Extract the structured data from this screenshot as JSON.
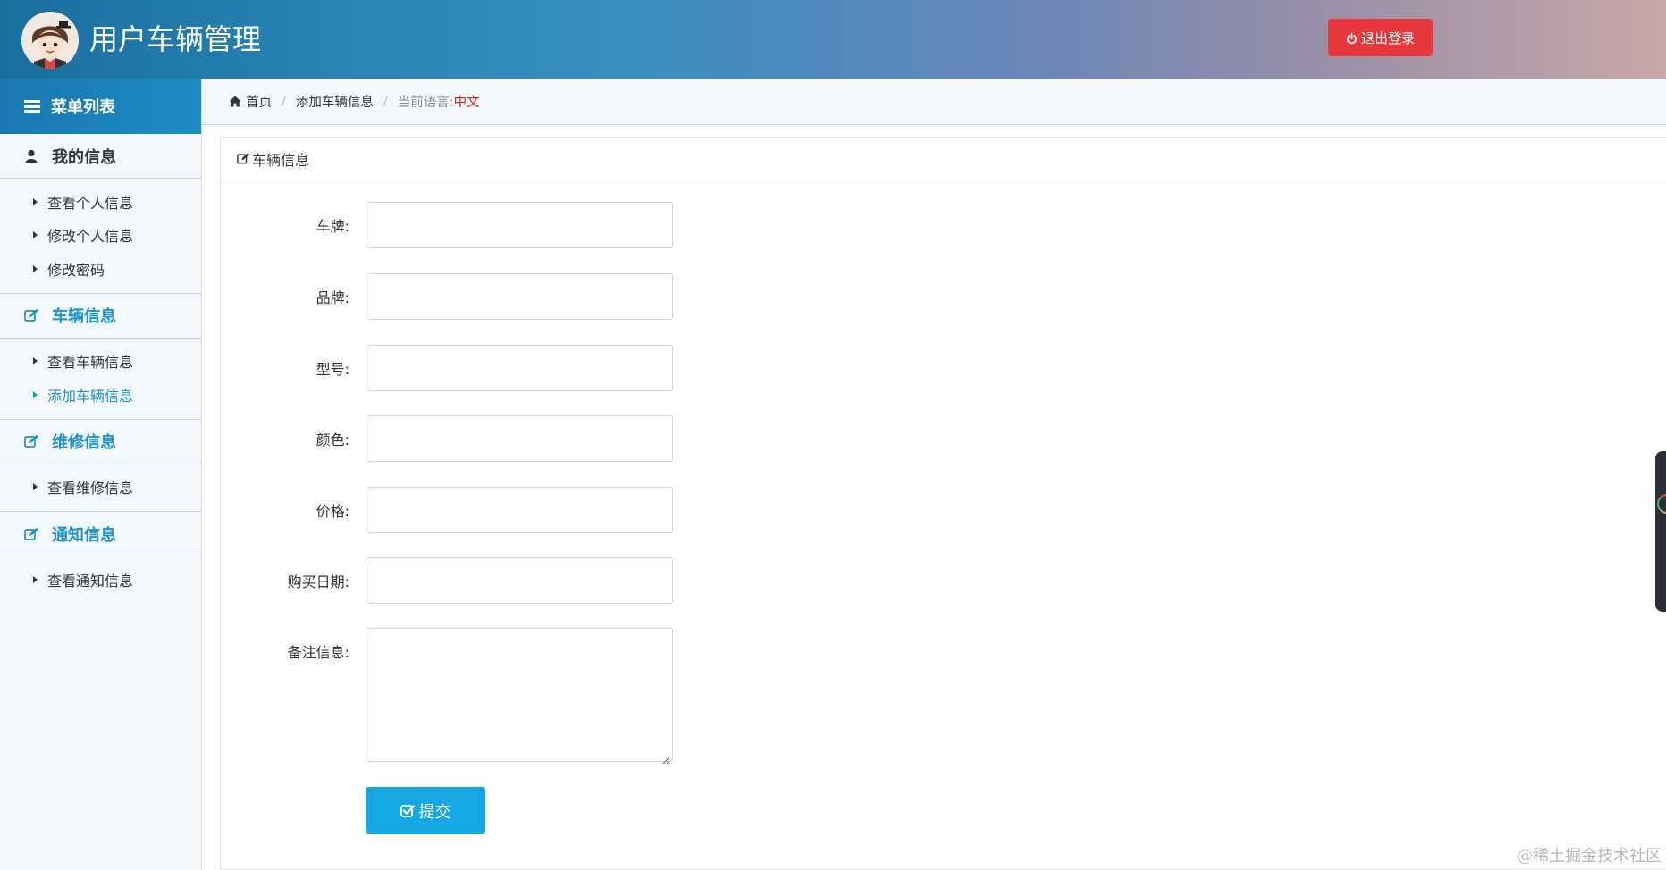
{
  "header": {
    "title": "用户车辆管理",
    "logout_label": "退出登录"
  },
  "sidebar": {
    "menu_title": "菜单列表",
    "groups": [
      {
        "label": "我的信息",
        "items": [
          "查看个人信息",
          "修改个人信息",
          "修改密码"
        ]
      },
      {
        "label": "车辆信息",
        "items": [
          "查看车辆信息",
          "添加车辆信息"
        ]
      },
      {
        "label": "维修信息",
        "items": [
          "查看维修信息"
        ]
      },
      {
        "label": "通知信息",
        "items": [
          "查看通知信息"
        ]
      }
    ],
    "active_item": "添加车辆信息"
  },
  "breadcrumb": {
    "home": "首页",
    "current": "添加车辆信息",
    "lang_label": "当前语言:",
    "lang_value": "中文"
  },
  "panel": {
    "title": "车辆信息",
    "fields": [
      {
        "label": "车牌:",
        "value": ""
      },
      {
        "label": "品牌:",
        "value": ""
      },
      {
        "label": "型号:",
        "value": ""
      },
      {
        "label": "颜色:",
        "value": ""
      },
      {
        "label": "价格:",
        "value": ""
      },
      {
        "label": "购买日期:",
        "value": ""
      },
      {
        "label": "备注信息:",
        "value": ""
      }
    ],
    "submit_label": "提交"
  },
  "watermark": "@稀土掘金技术社区",
  "colors": {
    "accent": "#1d93c9",
    "logout": "#e8383d",
    "submit": "#16a8e4",
    "lang": "#d0271f"
  },
  "icons": {
    "menu": "bars-icon",
    "user": "user-icon",
    "edit": "edit-icon",
    "home": "home-icon",
    "power": "power-icon",
    "check": "check-square-icon"
  }
}
